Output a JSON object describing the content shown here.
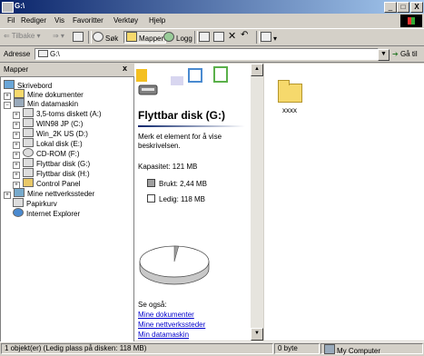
{
  "window": {
    "title": "G:\\",
    "buttons": [
      "_",
      "□",
      "X"
    ]
  },
  "menu": [
    "Fil",
    "Rediger",
    "Vis",
    "Favoritter",
    "Verktøy",
    "Hjelp"
  ],
  "toolbar": {
    "back": "Tilbake",
    "search": "Søk",
    "folders": "Mapper",
    "history": "Logg"
  },
  "address": {
    "label": "Adresse",
    "value": "G:\\",
    "go": "Gå til"
  },
  "folders_pane": {
    "title": "Mapper",
    "close": "x",
    "tree": [
      {
        "label": "Skrivebord"
      },
      {
        "label": "Mine dokumenter"
      },
      {
        "label": "Min datamaskin"
      },
      {
        "label": "3,5-toms diskett (A:)"
      },
      {
        "label": "WIN98 JP (C:)"
      },
      {
        "label": "Win_2K US (D:)"
      },
      {
        "label": "Lokal disk (E:)"
      },
      {
        "label": "CD-ROM (F:)"
      },
      {
        "label": "Flyttbar disk (G:)"
      },
      {
        "label": "Flyttbar disk (H:)"
      },
      {
        "label": "Control Panel"
      },
      {
        "label": "Mine nettverkssteder"
      },
      {
        "label": "Papirkurv"
      },
      {
        "label": "Internet Explorer"
      }
    ]
  },
  "webview": {
    "drive_title": "Flyttbar disk (G:)",
    "description": "Merk et element for å vise beskrivelsen.",
    "capacity": "Kapasitet: 121 MB",
    "used": "Brukt: 2,44 MB",
    "free": "Ledig: 118 MB",
    "see_also": "Se også:",
    "links": [
      "Mine dokumenter",
      "Mine nettverkssteder",
      "Min datamaskin"
    ],
    "used_fraction": 0.02
  },
  "files": [
    {
      "name": "xxxx"
    }
  ],
  "status": {
    "objects": "1 objekt(er) (Ledig plass på disken: 118 MB)",
    "size": "0 byte",
    "location": "My Computer"
  },
  "colors": {
    "titlebar": "#0a246a",
    "window": "#d4d0c8",
    "link": "#0000cc",
    "folder": "#f6d96c"
  }
}
